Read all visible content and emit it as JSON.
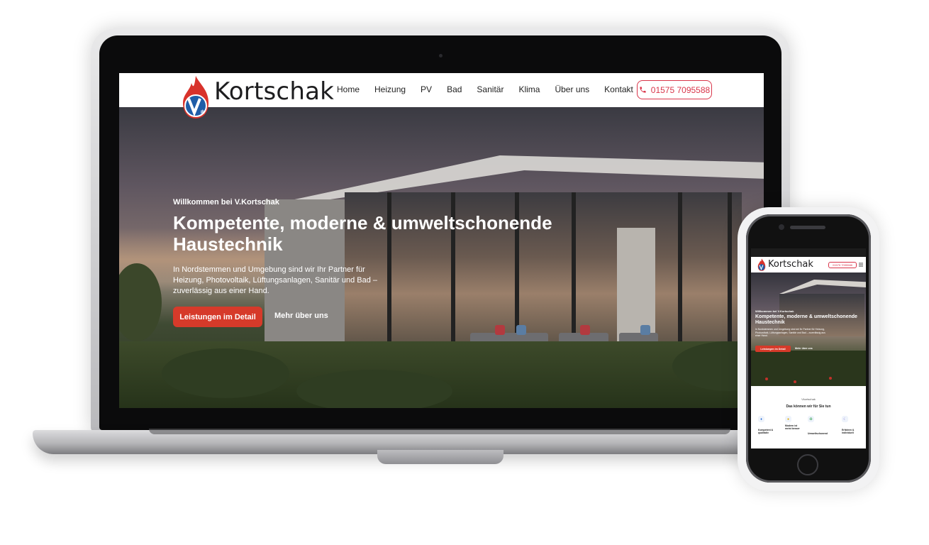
{
  "site": {
    "logo_text": "Kortschak",
    "nav": [
      "Home",
      "Heizung",
      "PV",
      "Bad",
      "Sanitär",
      "Klima",
      "Über uns",
      "Kontakt"
    ],
    "phone": "01575 7095588"
  },
  "hero": {
    "eyebrow": "Willkommen bei V.Kortschak",
    "title": "Kompetente, moderne & umweltschonende Haustechnik",
    "text": "In Nordstemmen und Umgebung sind wir Ihr Partner für Heizung, Photovoltaik, Lüftungsanlagen, Sanitär und Bad – zuverlässig aus einer Hand.",
    "primary_button": "Leistungen im Detail",
    "secondary_link": "Mehr über uns"
  },
  "mobile": {
    "logo_text": "Kortschak",
    "phone": "01575 7095588",
    "eyebrow": "Willkommen bei V.Kortschak",
    "title": "Kompetente, moderne & umweltschonende Haustechnik",
    "text": "In Nordstemmen und Umgebung sind wir Ihr Partner für Heizung, Photovoltaik, Lüftungsanlagen, Sanitär und Bad – zuverlässig aus einer Hand.",
    "primary_button": "Leistungen im Detail",
    "secondary_link": "Mehr über uns",
    "section_eyebrow": "Vkortschak",
    "section_title": "Das können wir für Sie tun",
    "features": [
      {
        "icon": "drop-icon",
        "label": "Kompetent & qualitativ"
      },
      {
        "icon": "bulb-icon",
        "label": "Modern ist meist besser"
      },
      {
        "icon": "recycle-icon",
        "label": "Umweltschonend"
      },
      {
        "icon": "moon-icon",
        "label": "Erfahren & individuell"
      }
    ]
  },
  "colors": {
    "accent_red": "#d63a2a",
    "phone_border": "#d9354a",
    "text_dark": "#1d1d1f"
  }
}
